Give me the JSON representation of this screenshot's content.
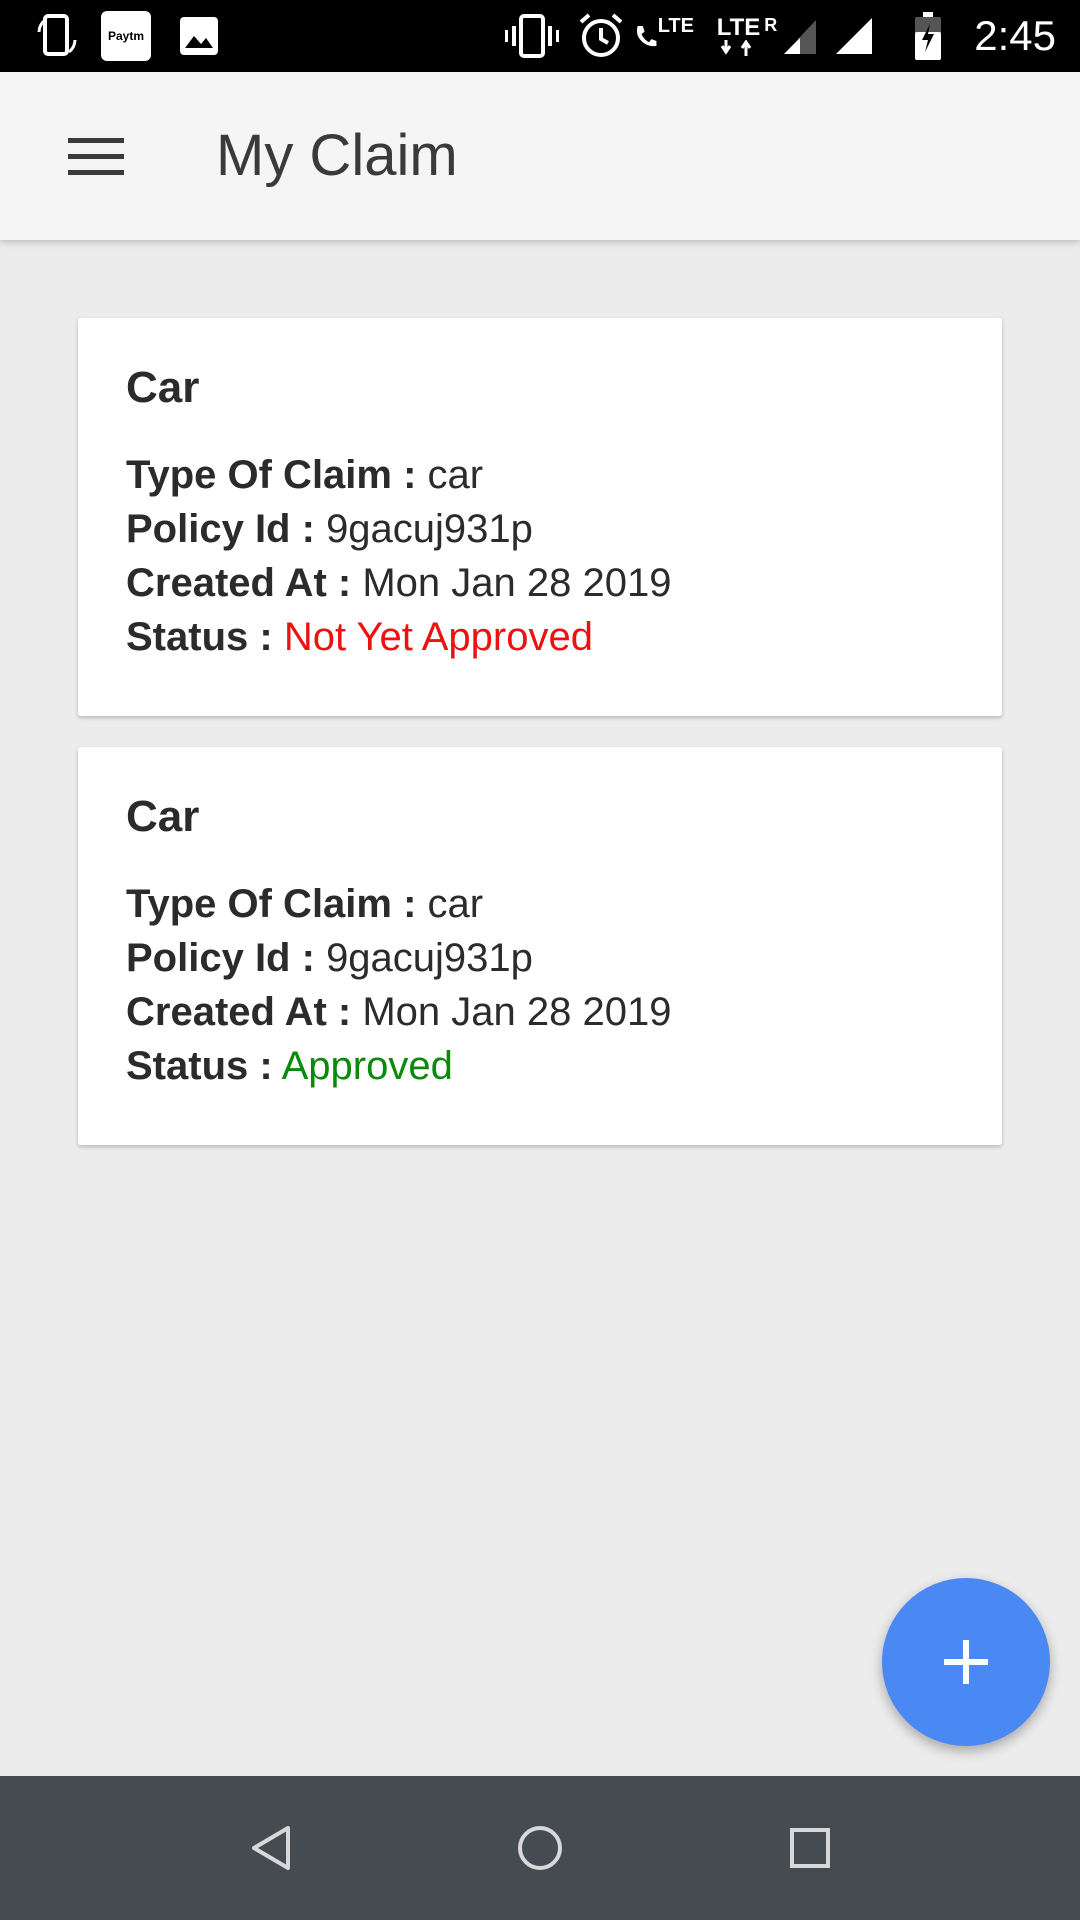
{
  "status_bar": {
    "time": "2:45",
    "paytm_label": "Paytm",
    "lte_label": "LTE",
    "lte2_label": "LTE",
    "roaming_label": "R",
    "icons": [
      "screen-rotate-icon",
      "paytm-icon",
      "image-icon",
      "vibrate-icon",
      "alarm-icon",
      "volte-call-icon",
      "lte-data-icon",
      "signal-icon",
      "battery-charging-icon"
    ]
  },
  "app_bar": {
    "title": "My Claim",
    "menu_icon": "hamburger-menu-icon"
  },
  "claims": [
    {
      "title": "Car",
      "type_label": "Type Of Claim :",
      "type_value": "car",
      "policy_label": "Policy Id :",
      "policy_value": "9gacuj931p",
      "created_label": "Created At :",
      "created_value": "Mon Jan 28 2019",
      "status_label": "Status :",
      "status_value": "Not Yet Approved",
      "status_color": "#ee1111"
    },
    {
      "title": "Car",
      "type_label": "Type Of Claim :",
      "type_value": "car",
      "policy_label": "Policy Id :",
      "policy_value": "9gacuj931p",
      "created_label": "Created At :",
      "created_value": "Mon Jan 28 2019",
      "status_label": "Status :",
      "status_value": "Approved",
      "status_color": "#0a8a0a"
    }
  ],
  "fab": {
    "icon": "plus-icon",
    "color": "#4a89f3"
  },
  "nav_bar": {
    "icons": [
      "back-icon",
      "home-icon",
      "recents-icon"
    ]
  }
}
